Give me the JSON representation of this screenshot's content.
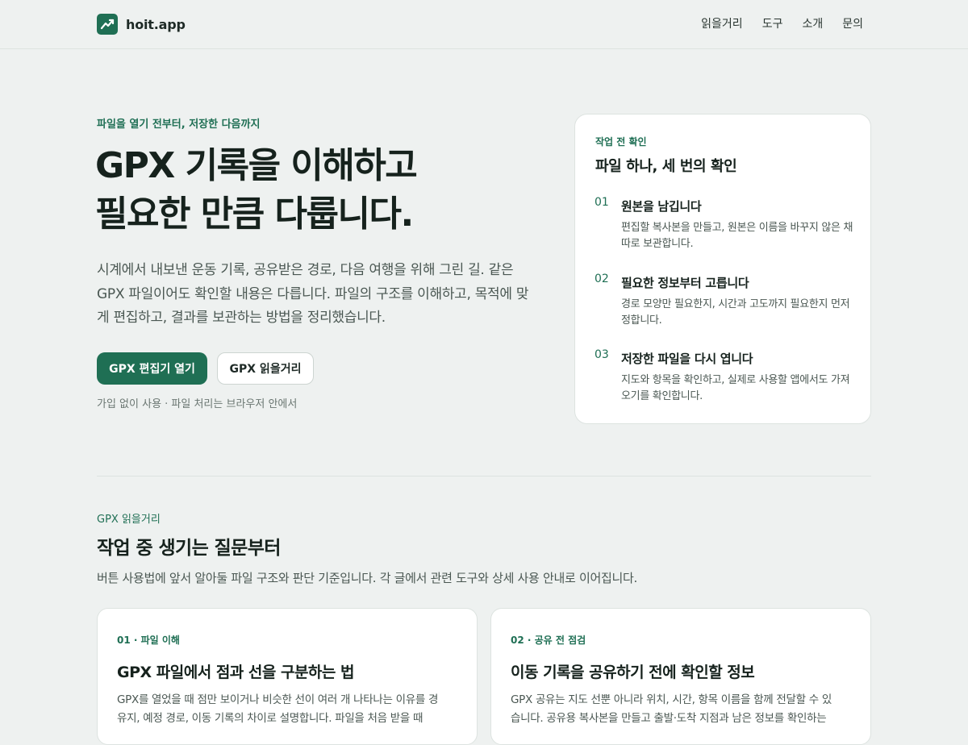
{
  "header": {
    "brand": "hoit.app",
    "nav": [
      "읽을거리",
      "도구",
      "소개",
      "문의"
    ]
  },
  "hero": {
    "eyebrow": "파일을 열기 전부터, 저장한 다음까지",
    "title_line1": "GPX 기록을 이해하고",
    "title_line2": "필요한 만큼 다룹니다.",
    "description": "시계에서 내보낸 운동 기록, 공유받은 경로, 다음 여행을 위해 그린 길. 같은 GPX 파일이어도 확인할 내용은 다릅니다. 파일의 구조를 이해하고, 목적에 맞게 편집하고, 결과를 보관하는 방법을 정리했습니다.",
    "primary_button": "GPX 편집기 열기",
    "secondary_button": "GPX 읽을거리",
    "note": "가입 없이 사용 · 파일 처리는 브라우저 안에서"
  },
  "checklist": {
    "eyebrow": "작업 전 확인",
    "title": "파일 하나, 세 번의 확인",
    "steps": [
      {
        "num": "01",
        "title": "원본을 남깁니다",
        "desc": "편집할 복사본을 만들고, 원본은 이름을 바꾸지 않은 채 따로 보관합니다."
      },
      {
        "num": "02",
        "title": "필요한 정보부터 고릅니다",
        "desc": "경로 모양만 필요한지, 시간과 고도까지 필요한지 먼저 정합니다."
      },
      {
        "num": "03",
        "title": "저장한 파일을 다시 엽니다",
        "desc": "지도와 항목을 확인하고, 실제로 사용할 앱에서도 가져오기를 확인합니다."
      }
    ]
  },
  "reading": {
    "eyebrow": "GPX 읽을거리",
    "title": "작업 중 생기는 질문부터",
    "description": "버튼 사용법에 앞서 알아둘 파일 구조와 판단 기준입니다. 각 글에서 관련 도구와 상세 사용 안내로 이어집니다.",
    "articles": [
      {
        "tag": "01 · 파일 이해",
        "title": "GPX 파일에서 점과 선을 구분하는 법",
        "desc": "GPX를 열었을 때 점만 보이거나 비슷한 선이 여러 개 나타나는 이유를 경유지, 예정 경로, 이동 기록의 차이로 설명합니다. 파일을 처음 받을 때"
      },
      {
        "tag": "02 · 공유 전 점검",
        "title": "이동 기록을 공유하기 전에 확인할 정보",
        "desc": "GPX 공유는 지도 선뿐 아니라 위치, 시간, 항목 이름을 함께 전달할 수 있습니다. 공유용 복사본을 만들고 출발·도착 지점과 남은 정보를 확인하는"
      }
    ]
  },
  "colors": {
    "accent": "#1f6f54",
    "background": "#eef1f0",
    "card": "#ffffff",
    "text": "#16221d"
  }
}
